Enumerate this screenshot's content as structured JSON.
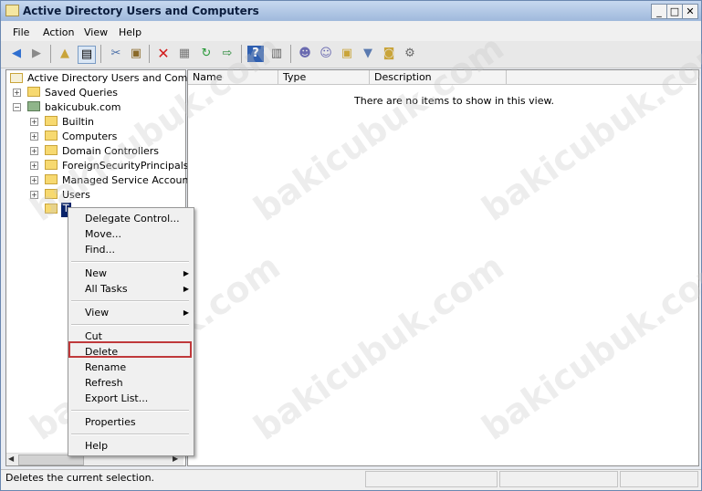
{
  "window": {
    "title": "Active Directory Users and Computers",
    "minimize_glyph": "_",
    "restore_glyph": "□",
    "close_glyph": "✕"
  },
  "menubar": [
    "File",
    "Action",
    "View",
    "Help"
  ],
  "toolbar": [
    "back-arrow-icon",
    "forward-arrow-icon",
    "up-folder-icon",
    "show-hide-tree-icon",
    "cut-icon",
    "paste-icon",
    "delete-icon",
    "properties-icon",
    "refresh-icon",
    "export-icon",
    "help-icon",
    "snapin-icon",
    "add-user-icon",
    "add-group-icon",
    "add-ou-icon",
    "filter-icon",
    "find-icon",
    "delegate-icon"
  ],
  "tree": {
    "root": "Active Directory Users and Comput",
    "saved_queries": "Saved Queries",
    "domain": "bakicubuk.com",
    "children": [
      "Builtin",
      "Computers",
      "Domain Controllers",
      "ForeignSecurityPrincipals",
      "Managed Service Accounts",
      "Users"
    ],
    "selected_ou": "T"
  },
  "list": {
    "columns": [
      "Name",
      "Type",
      "Description"
    ],
    "empty_message": "There are no items to show in this view."
  },
  "context_menu": {
    "group1": [
      "Delegate Control...",
      "Move...",
      "Find..."
    ],
    "group2": [
      "New",
      "All Tasks"
    ],
    "group3": [
      "View"
    ],
    "group4": [
      "Cut",
      "Delete",
      "Rename",
      "Refresh",
      "Export List..."
    ],
    "group5": [
      "Properties"
    ],
    "group6": [
      "Help"
    ],
    "highlighted": "Delete"
  },
  "statusbar": {
    "text": "Deletes the current selection."
  },
  "watermark": "bakicubuk.com",
  "colors": {
    "highlight_border": "#c0393b",
    "title_gradient_top": "#c7d8ef"
  }
}
